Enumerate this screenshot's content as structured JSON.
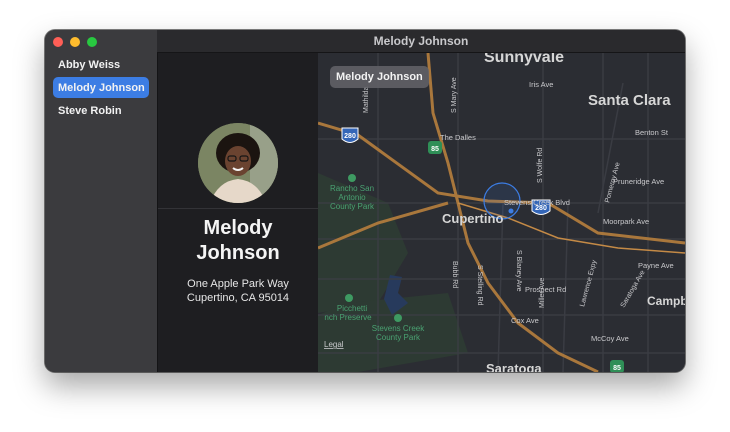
{
  "window": {
    "title": "Melody Johnson"
  },
  "sidebar": {
    "people": [
      {
        "name": "Abby Weiss",
        "selected": false
      },
      {
        "name": "Melody Johnson",
        "selected": true
      },
      {
        "name": "Steve Robin",
        "selected": false
      }
    ]
  },
  "detail": {
    "name_line1": "Melody",
    "name_line2": "Johnson",
    "address_line1": "One Apple Park Way",
    "address_line2": "Cupertino, CA 95014"
  },
  "map": {
    "pin_label": "Melody Johnson",
    "legal": "Legal",
    "labels": {
      "sunnyvale": "Sunnyvale",
      "santa_clara": "Santa Clara",
      "cupertino": "Cupertino",
      "saratoga": "Saratoga",
      "campbell": "Campb",
      "the_dalles": "The Dalles",
      "iris_ave": "Iris Ave",
      "benton_st": "Benton St",
      "pruneridge_ave": "Pruneridge Ave",
      "moorpark_ave": "Moorpark Ave",
      "payne_ave": "Payne Ave",
      "prospect_rd": "Prospect Rd",
      "cox_ave": "Cox Ave",
      "mccoy_ave": "McCoy Ave",
      "stevens_creek_blvd": "Stevens Creek Blvd",
      "mary_ave": "S Mary Ave",
      "mathilda": "Mathilda",
      "s_wolfe_rd": "S Wolfe Rd",
      "pomeroy_ave": "Pomeroy Ave",
      "bubb_rd": "Bubb Rd",
      "s_stelling_rd": "S Stelling Rd",
      "s_blaney_ave": "S Blaney Ave",
      "miller_ave": "Miller Ave",
      "lawrence_expy": "Lawrence Expy",
      "saratoga_ave": "Saratoga Ave",
      "rancho1": "Rancho San",
      "rancho2": "Antonio",
      "rancho3": "County Park",
      "picchetti1": "Picchetti",
      "picchetti2": "nch Preserve",
      "stevens1": "Stevens Creek",
      "stevens2": "County Park",
      "hwy_280a": "280",
      "hwy_280b": "280",
      "hwy_85a": "85",
      "hwy_85b": "85"
    },
    "colors": {
      "land": "#2b2d33",
      "park": "#2d3a33",
      "road": "#3a3c43",
      "highway": "#a9773c",
      "interstate": "#3466b8",
      "accuracy": "#3c7de4"
    }
  }
}
